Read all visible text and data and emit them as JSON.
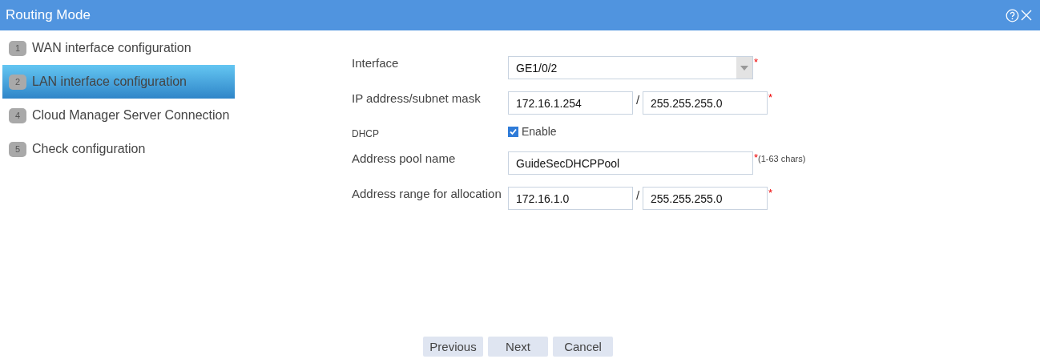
{
  "window": {
    "title": "Routing Mode"
  },
  "steps": [
    {
      "number": "1",
      "label": "WAN interface configuration",
      "selected": false
    },
    {
      "number": "2",
      "label": "LAN interface configuration",
      "selected": true
    },
    {
      "number": "4",
      "label": "Cloud Manager Server Connection",
      "selected": false
    },
    {
      "number": "5",
      "label": "Check configuration",
      "selected": false
    }
  ],
  "form": [
    {
      "kind": "select",
      "label": "Interface",
      "value": "GE1/0/2",
      "required_mark": "*"
    },
    {
      "kind": "ip_mask",
      "label": "IP address/subnet mask",
      "value": "172.16.1.254",
      "separator": "/",
      "mask": "255.255.255.0",
      "required_mark": "*"
    },
    {
      "kind": "checkbox",
      "label": "DHCP",
      "option": "Enable",
      "checked": true
    },
    {
      "kind": "text",
      "label": "Address pool name",
      "value": "GuideSecDHCPPool",
      "required_mark": "*",
      "hint": "(1-63 chars)"
    },
    {
      "kind": "ip_mask",
      "label": "Address range for allocation",
      "value": "172.16.1.0",
      "separator": "/",
      "mask": "255.255.255.0",
      "required_mark": "*"
    }
  ],
  "buttons": [
    "Previous",
    "Next",
    "Cancel"
  ]
}
